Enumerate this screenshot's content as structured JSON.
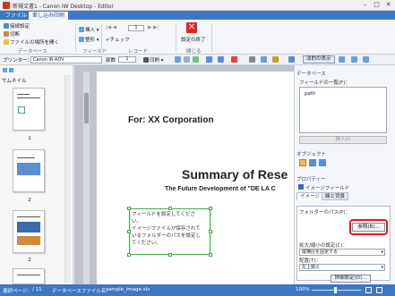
{
  "window": {
    "title": "新規文書1 - Canon iW Desktop - Editor",
    "minimize": "–",
    "maximize": "□",
    "close": "✕"
  },
  "ribbon_tabs": [
    "ファイル",
    "差し込み印刷"
  ],
  "ribbon": {
    "datasource": {
      "connect": "接続設定",
      "disconnect": "切断",
      "open_file_location": "ファイルの場所を開く",
      "group": "データベース"
    },
    "field": {
      "insert": "挿入",
      "delete": "整形",
      "group": "フィールド"
    },
    "record": {
      "current": "1",
      "check": "チェック",
      "group": "レコード"
    },
    "finish": {
      "label": "設定の終了",
      "group": "閉じる"
    }
  },
  "toolbar2": {
    "printer_label": "プリンター：",
    "printer": "Canon iR-ADV",
    "copies_label": "部数",
    "copies": "1",
    "print": "印刷",
    "legal_view": "法的の表示"
  },
  "left_panel": {
    "title": "サムネイル",
    "thumb_numbers": [
      "1",
      "2",
      "2",
      "2"
    ]
  },
  "document": {
    "for_line": "For: XX Corporation",
    "summary": "Summary of Rese",
    "subtitle": "The Future Development of \"DE LA C",
    "field_box_line1": "フィールドを設定してくださ",
    "field_box_line2": "い。",
    "field_box_line3": "イメージファイルが保存されて",
    "field_box_line4": "いるフォルダーのパスを設定し",
    "field_box_line5": "てください。"
  },
  "right_panel": {
    "db_header": "データベース",
    "field_list_label": "フィールドの一覧(F)：",
    "field_item": "path",
    "insert_button": "挿入(I)",
    "object_header": "オブジェクト",
    "property_header": "プロパティー",
    "image_field": "イメージフィールド",
    "tab_image": "イメージ",
    "tab_line": "線と背景",
    "folder_path_label": "フォルダーのパス(P)：",
    "ref_button": "参照(B)...",
    "scale_label": "拡大/縮小の設定(C)：",
    "scale_value": "縦横比を固定する",
    "position_label": "配置(T)：",
    "position_value": "左上揃え",
    "detail_button": "詳細設定(D)..."
  },
  "status_bar": {
    "page_label": "選択ページ：",
    "page_value": "/ 11",
    "db_file_label": "データベースファイル名：",
    "db_file": "sample_image.xls",
    "zoom": "100%"
  },
  "colors": {
    "accent": "#3c78c3",
    "highlight": "#e01b1b"
  }
}
